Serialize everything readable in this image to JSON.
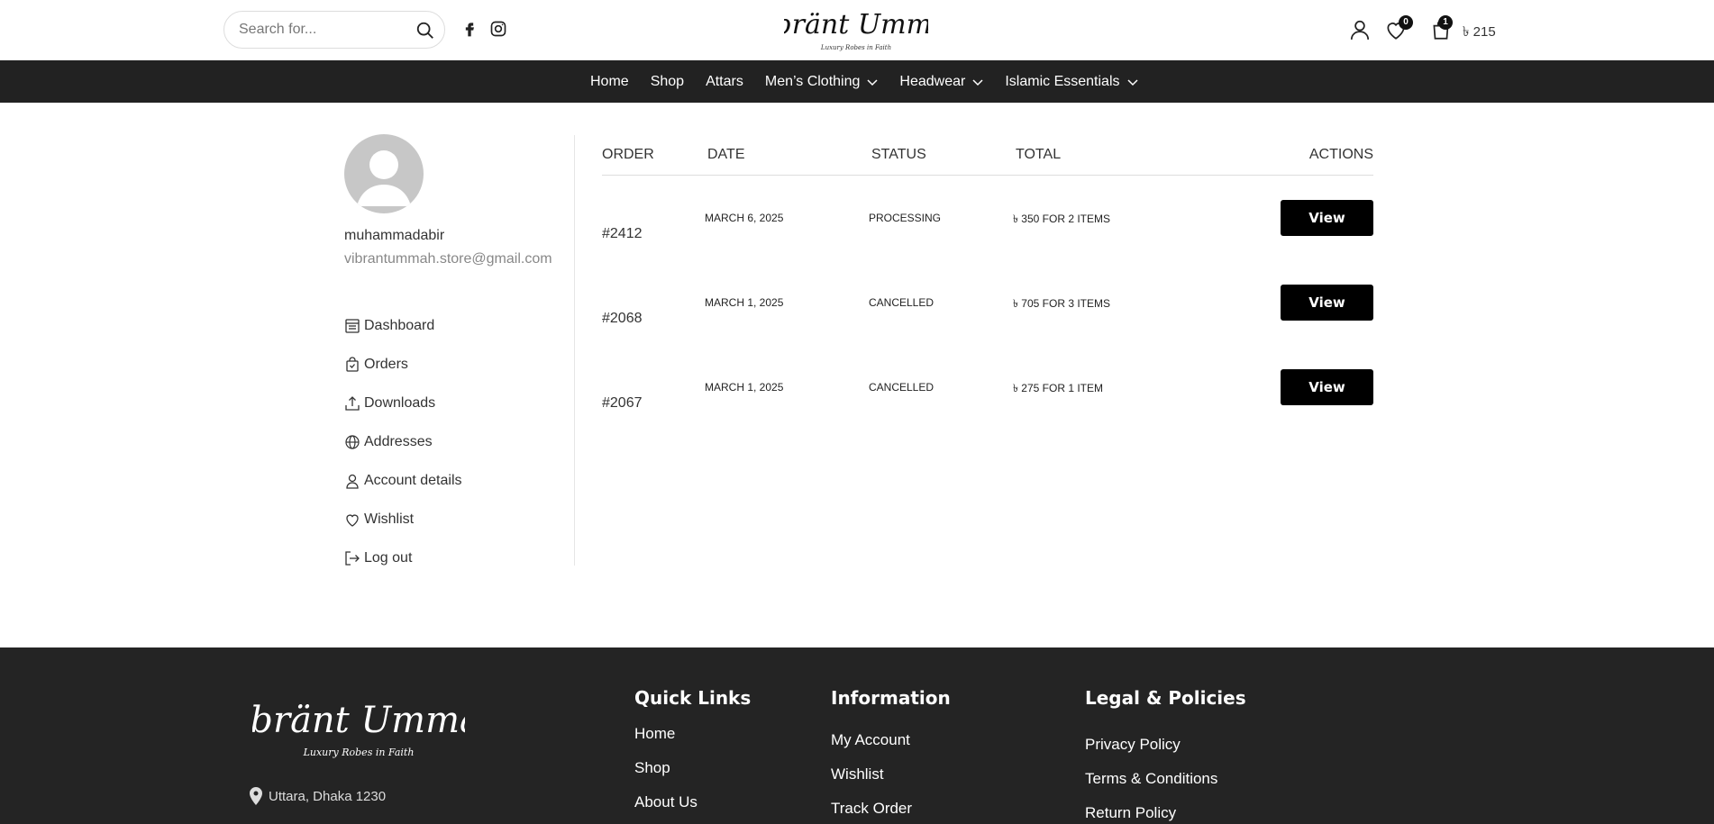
{
  "header": {
    "search_placeholder": "Search for...",
    "brand": "Vibränt Ummäh",
    "tagline": "Luxury Robes in Faith",
    "wishlist_count": "0",
    "cart_count": "1",
    "cart_total": "৳ 215"
  },
  "nav": {
    "items": [
      {
        "label": "Home"
      },
      {
        "label": "Shop"
      },
      {
        "label": "Attars"
      },
      {
        "label": "Men’s Clothing"
      },
      {
        "label": "Headwear"
      },
      {
        "label": "Islamic Essentials"
      }
    ]
  },
  "account": {
    "username": "muhammadabir",
    "email": "vibrantummah.store@gmail.com",
    "menu": [
      {
        "label": "Dashboard",
        "icon": "dashboard-icon"
      },
      {
        "label": "Orders",
        "icon": "bag-icon"
      },
      {
        "label": "Downloads",
        "icon": "upload-icon"
      },
      {
        "label": "Addresses",
        "icon": "globe-icon"
      },
      {
        "label": "Account details",
        "icon": "user-icon"
      },
      {
        "label": "Wishlist",
        "icon": "heart-icon"
      },
      {
        "label": "Log out",
        "icon": "logout-icon"
      }
    ]
  },
  "orders": {
    "columns": {
      "order": "ORDER",
      "date": "DATE",
      "status": "STATUS",
      "total": "TOTAL",
      "actions": "ACTIONS"
    },
    "rows": [
      {
        "number": "#2412",
        "date": "March 6, 2025",
        "status": "Processing",
        "total": "৳ 350 for 2 items",
        "action": "View"
      },
      {
        "number": "#2068",
        "date": "March 1, 2025",
        "status": "Cancelled",
        "total": "৳ 705 for 3 items",
        "action": "View"
      },
      {
        "number": "#2067",
        "date": "March 1, 2025",
        "status": "Cancelled",
        "total": "৳ 275 for 1 item",
        "action": "View"
      }
    ]
  },
  "footer": {
    "address": "Uttara, Dhaka 1230",
    "quick_links": {
      "title": "Quick Links",
      "items": [
        "Home",
        "Shop",
        "About Us"
      ]
    },
    "information": {
      "title": "Information",
      "items": [
        "My Account",
        "Wishlist",
        "Track Order"
      ]
    },
    "legal": {
      "title": "Legal & Policies",
      "items": [
        "Privacy Policy",
        "Terms & Conditions",
        "Return Policy"
      ]
    }
  },
  "colors": {
    "nav_bg": "#222222",
    "footer_bg": "#242424",
    "button_bg": "#000000"
  }
}
